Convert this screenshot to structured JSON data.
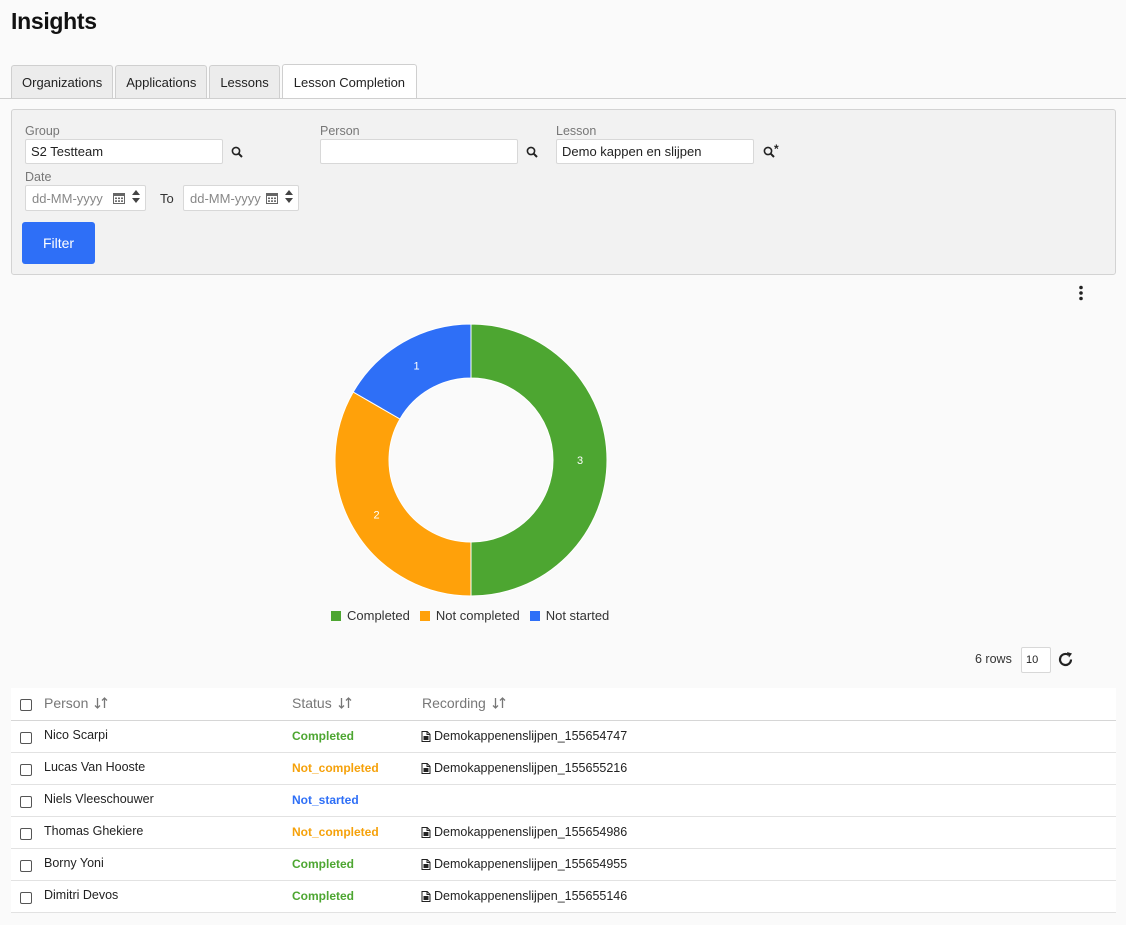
{
  "page_title": "Insights",
  "tabs": [
    {
      "label": "Organizations",
      "active": false
    },
    {
      "label": "Applications",
      "active": false
    },
    {
      "label": "Lessons",
      "active": false
    },
    {
      "label": "Lesson Completion",
      "active": true
    }
  ],
  "filters": {
    "group_label": "Group",
    "group_value": "S2 Testteam",
    "person_label": "Person",
    "person_value": "",
    "lesson_label": "Lesson",
    "lesson_value": "Demo kappen en slijpen",
    "lesson_star": "*",
    "date_label": "Date",
    "date_from_placeholder": "dd-MM-yyyy",
    "to_label": "To",
    "date_to_placeholder": "dd-MM-yyyy",
    "filter_button": "Filter"
  },
  "chart_data": {
    "type": "pie",
    "donut": true,
    "categories": [
      "Completed",
      "Not completed",
      "Not started"
    ],
    "values": [
      3,
      2,
      1
    ],
    "colors": [
      "#4da631",
      "#ffa10a",
      "#2e6ff7"
    ],
    "legend_position": "bottom"
  },
  "table_controls": {
    "rows_count": "6 rows",
    "page_size": "10"
  },
  "table": {
    "headers": {
      "person": "Person",
      "status": "Status",
      "recording": "Recording"
    },
    "rows": [
      {
        "person": "Nico Scarpi",
        "status": "Completed",
        "recording": "Demokappenenslijpen_155654747"
      },
      {
        "person": "Lucas Van Hooste",
        "status": "Not_completed",
        "recording": "Demokappenenslijpen_155655216"
      },
      {
        "person": "Niels Vleeschouwer",
        "status": "Not_started",
        "recording": ""
      },
      {
        "person": "Thomas Ghekiere",
        "status": "Not_completed",
        "recording": "Demokappenenslijpen_155654986"
      },
      {
        "person": "Borny Yoni",
        "status": "Completed",
        "recording": "Demokappenenslijpen_155654955"
      },
      {
        "person": "Dimitri Devos",
        "status": "Completed",
        "recording": "Demokappenenslijpen_155655146"
      }
    ]
  }
}
